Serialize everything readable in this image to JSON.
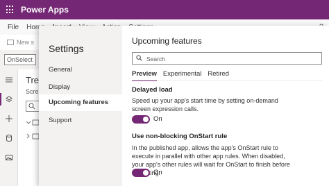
{
  "app": {
    "title": "Power Apps"
  },
  "menubar": {
    "items": [
      "File",
      "Home",
      "Insert",
      "View",
      "Action",
      "Settings"
    ],
    "help": "?"
  },
  "toolbar": {
    "new_screen": "New s"
  },
  "formula_bar": {
    "property": "OnSelect"
  },
  "tree_view": {
    "title": "Tree",
    "tab": "Scre"
  },
  "settings": {
    "title": "Settings",
    "nav": [
      "General",
      "Display",
      "Upcoming features",
      "Support"
    ],
    "selected_nav": "Upcoming features",
    "heading": "Upcoming features",
    "search_placeholder": "Search",
    "tabs": [
      "Preview",
      "Experimental",
      "Retired"
    ],
    "active_tab": "Preview",
    "features": [
      {
        "title": "Delayed load",
        "description": "Speed up your app's start time by setting on-demand screen expression calls.",
        "state": "On"
      },
      {
        "title": "Use non-blocking OnStart rule",
        "description": "In the published app, allows the app's OnStart rule to execute in parallel with other app rules. When disabled, your app's other rules will wait for OnStart to finish before executing.",
        "state": "On"
      }
    ]
  },
  "colors": {
    "brand": "#742774",
    "nav_bg": "#f3f2f1"
  }
}
